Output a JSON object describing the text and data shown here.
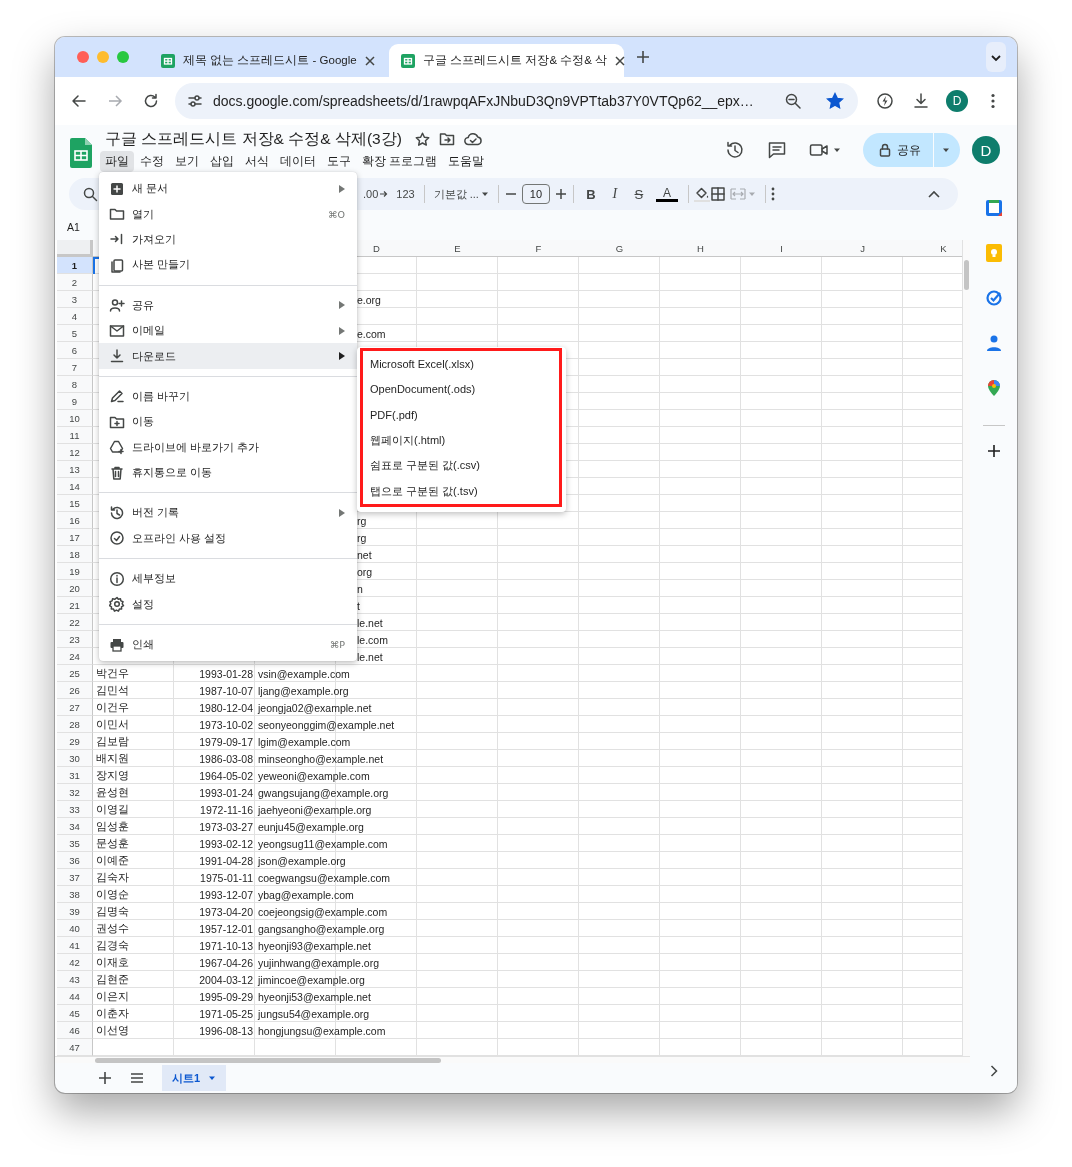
{
  "browser": {
    "tabs": [
      {
        "title": "제목 없는 스프레드시트 - Google",
        "selected": false
      },
      {
        "title": "구글 스프레드시트 저장& 수정& 삭",
        "selected": true
      }
    ],
    "url": "docs.google.com/spreadsheets/d/1rawpqAFxJNbuD3Qn9VPTtab37Y0VTQp62__epx…",
    "bookmarked": true,
    "profile": "D"
  },
  "document": {
    "title": "구글 스프레드시트 저장& 수정& 삭제(3강)",
    "menus": [
      {
        "label": "파일",
        "selected": true
      },
      {
        "label": "수정",
        "selected": false
      },
      {
        "label": "보기",
        "selected": false
      },
      {
        "label": "삽입",
        "selected": false
      },
      {
        "label": "서식",
        "selected": false
      },
      {
        "label": "데이터",
        "selected": false
      },
      {
        "label": "도구",
        "selected": false
      },
      {
        "label": "확장 프로그램",
        "selected": false
      },
      {
        "label": "도움말",
        "selected": false
      }
    ],
    "share": "공유",
    "account": "D"
  },
  "toolbar": {
    "decimal": ".00",
    "number_format": "123",
    "font": "기본값 ...",
    "font_size": "10",
    "format": [
      {
        "kind": "bold",
        "label": "B"
      },
      {
        "kind": "italic",
        "label": "I"
      },
      {
        "kind": "strikethrough",
        "label": "S"
      },
      {
        "kind": "text_color",
        "label": "A"
      }
    ]
  },
  "name_box": "A1",
  "sheet": {
    "columns": [
      "D",
      "E",
      "F",
      "G",
      "H",
      "I",
      "J",
      "K"
    ],
    "rows": [
      {
        "number": "1",
        "selected": true
      },
      {
        "number": "2",
        "selected": false
      },
      {
        "number": "3",
        "selected": false,
        "overflow": "e.org"
      },
      {
        "number": "4",
        "selected": false
      },
      {
        "number": "5",
        "selected": false,
        "overflow": "e.com"
      },
      {
        "number": "6",
        "selected": false
      },
      {
        "number": "7",
        "selected": false
      },
      {
        "number": "8",
        "selected": false
      },
      {
        "number": "9",
        "selected": false
      },
      {
        "number": "10",
        "selected": false
      },
      {
        "number": "11",
        "selected": false
      },
      {
        "number": "12",
        "selected": false
      },
      {
        "number": "13",
        "selected": false
      },
      {
        "number": "14",
        "selected": false
      },
      {
        "number": "15",
        "selected": false
      },
      {
        "number": "16",
        "selected": false,
        "overflow": "rg"
      },
      {
        "number": "17",
        "selected": false,
        "overflow": "rg"
      },
      {
        "number": "18",
        "selected": false,
        "overflow": "net"
      },
      {
        "number": "19",
        "selected": false,
        "overflow": "org"
      },
      {
        "number": "20",
        "selected": false,
        "overflow": "n"
      },
      {
        "number": "21",
        "selected": false,
        "overflow": "t"
      },
      {
        "number": "22",
        "selected": false,
        "overflow": "le.net"
      },
      {
        "number": "23",
        "selected": false,
        "overflow": "le.com"
      },
      {
        "number": "24",
        "selected": false,
        "overflow": "le.net"
      },
      {
        "number": "25",
        "selected": false,
        "name": "박건우",
        "date": "1993-01-28",
        "email": "vsin@example.com"
      },
      {
        "number": "26",
        "selected": false,
        "name": "김민석",
        "date": "1987-10-07",
        "email": "ljang@example.org"
      },
      {
        "number": "27",
        "selected": false,
        "name": "이건우",
        "date": "1980-12-04",
        "email": "jeongja02@example.net"
      },
      {
        "number": "28",
        "selected": false,
        "name": "이민서",
        "date": "1973-10-02",
        "email": "seonyeonggim@example.net"
      },
      {
        "number": "29",
        "selected": false,
        "name": "김보람",
        "date": "1979-09-17",
        "email": "lgim@example.com"
      },
      {
        "number": "30",
        "selected": false,
        "name": "배지원",
        "date": "1986-03-08",
        "email": "minseongho@example.net"
      },
      {
        "number": "31",
        "selected": false,
        "name": "장지영",
        "date": "1964-05-02",
        "email": "yeweoni@example.com"
      },
      {
        "number": "32",
        "selected": false,
        "name": "윤성현",
        "date": "1993-01-24",
        "email": "gwangsujang@example.org"
      },
      {
        "number": "33",
        "selected": false,
        "name": "이영길",
        "date": "1972-11-16",
        "email": "jaehyeoni@example.org"
      },
      {
        "number": "34",
        "selected": false,
        "name": "임성훈",
        "date": "1973-03-27",
        "email": "eunju45@example.org"
      },
      {
        "number": "35",
        "selected": false,
        "name": "문성훈",
        "date": "1993-02-12",
        "email": "yeongsug11@example.com"
      },
      {
        "number": "36",
        "selected": false,
        "name": "이예준",
        "date": "1991-04-28",
        "email": "json@example.org"
      },
      {
        "number": "37",
        "selected": false,
        "name": "김숙자",
        "date": "1975-01-11",
        "email": "coegwangsu@example.com"
      },
      {
        "number": "38",
        "selected": false,
        "name": "이영순",
        "date": "1993-12-07",
        "email": "ybag@example.com"
      },
      {
        "number": "39",
        "selected": false,
        "name": "김명숙",
        "date": "1973-04-20",
        "email": "coejeongsig@example.com"
      },
      {
        "number": "40",
        "selected": false,
        "name": "권성수",
        "date": "1957-12-01",
        "email": "gangsangho@example.org"
      },
      {
        "number": "41",
        "selected": false,
        "name": "김경숙",
        "date": "1971-10-13",
        "email": "hyeonji93@example.net"
      },
      {
        "number": "42",
        "selected": false,
        "name": "이재호",
        "date": "1967-04-26",
        "email": "yujinhwang@example.org"
      },
      {
        "number": "43",
        "selected": false,
        "name": "김현준",
        "date": "2004-03-12",
        "email": "jimincoe@example.org"
      },
      {
        "number": "44",
        "selected": false,
        "name": "이은지",
        "date": "1995-09-29",
        "email": "hyeonji53@example.net"
      },
      {
        "number": "45",
        "selected": false,
        "name": "이춘자",
        "date": "1971-05-25",
        "email": "jungsu54@example.org"
      },
      {
        "number": "46",
        "selected": false,
        "name": "이선영",
        "date": "1996-08-13",
        "email": "hongjungsu@example.com"
      },
      {
        "number": "47",
        "selected": false
      }
    ]
  },
  "file_menu": {
    "groups": [
      [
        {
          "label": "새 문서",
          "submenu": true,
          "highlighted": false
        },
        {
          "label": "열기",
          "shortcut": "⌘O",
          "submenu": false,
          "highlighted": false
        },
        {
          "label": "가져오기",
          "submenu": false,
          "highlighted": false
        },
        {
          "label": "사본 만들기",
          "submenu": false,
          "highlighted": false
        }
      ],
      [
        {
          "label": "공유",
          "submenu": true,
          "highlighted": false
        },
        {
          "label": "이메일",
          "submenu": true,
          "highlighted": false
        },
        {
          "label": "다운로드",
          "submenu": true,
          "highlighted": true
        }
      ],
      [
        {
          "label": "이름 바꾸기",
          "submenu": false,
          "highlighted": false
        },
        {
          "label": "이동",
          "submenu": false,
          "highlighted": false
        },
        {
          "label": "드라이브에 바로가기 추가",
          "submenu": false,
          "highlighted": false
        },
        {
          "label": "휴지통으로 이동",
          "submenu": false,
          "highlighted": false
        }
      ],
      [
        {
          "label": "버전 기록",
          "submenu": true,
          "highlighted": false
        },
        {
          "label": "오프라인 사용 설정",
          "submenu": false,
          "highlighted": false
        }
      ],
      [
        {
          "label": "세부정보",
          "submenu": false,
          "highlighted": false
        },
        {
          "label": "설정",
          "submenu": false,
          "highlighted": false
        }
      ],
      [
        {
          "label": "인쇄",
          "shortcut": "⌘P",
          "submenu": false,
          "highlighted": false
        }
      ]
    ]
  },
  "download_submenu": {
    "items": [
      "Microsoft Excel(.xlsx)",
      "OpenDocument(.ods)",
      "PDF(.pdf)",
      "웹페이지(.html)",
      "쉼표로 구분된 값(.csv)",
      "탭으로 구분된 값(.tsv)"
    ]
  },
  "sheet_tabs": [
    {
      "label": "시트1",
      "selected": true
    }
  ]
}
